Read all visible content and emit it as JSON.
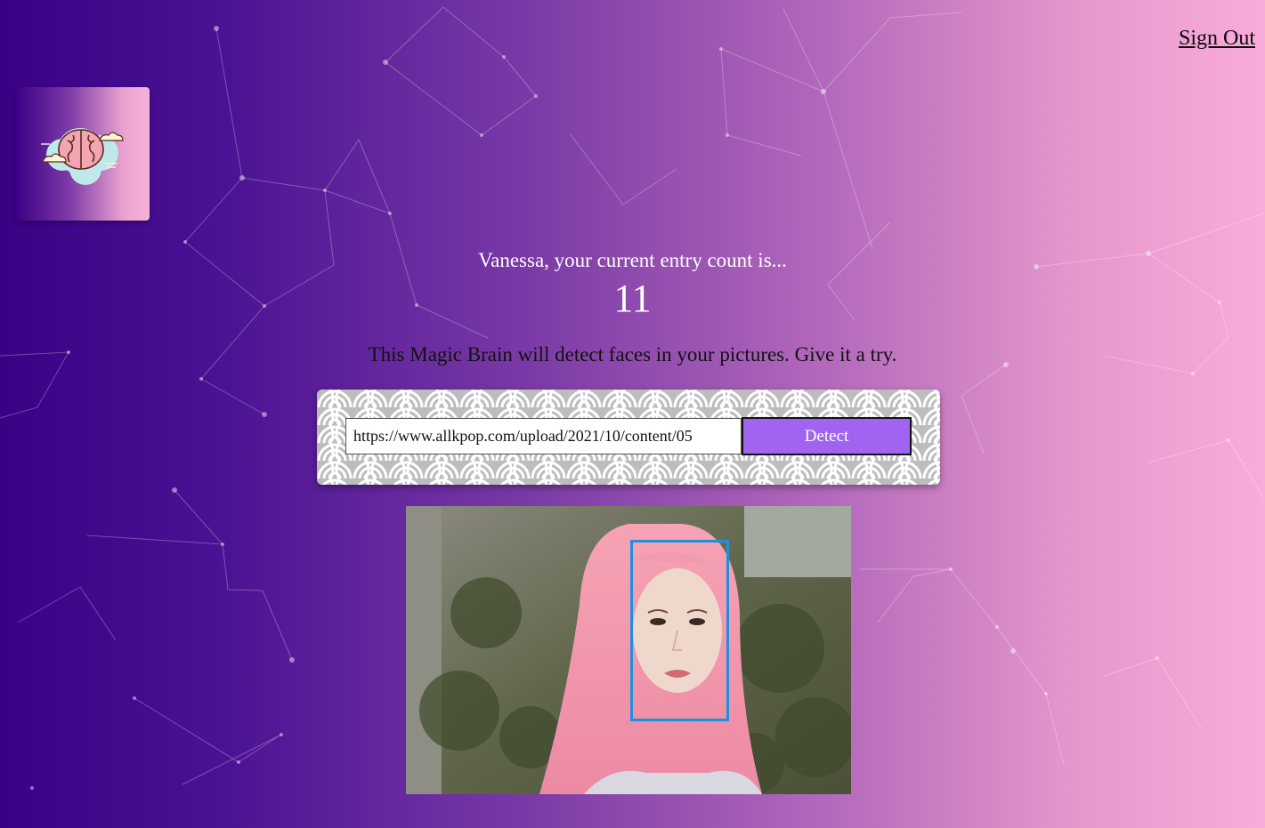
{
  "header": {
    "sign_out_label": "Sign Out"
  },
  "logo": {
    "icon": "brain-icon"
  },
  "rank": {
    "greeting": "Vanessa, your current entry count is...",
    "count": "11"
  },
  "intro": {
    "text": "This Magic Brain will detect faces in your pictures. Give it a try."
  },
  "form": {
    "url_value": "https://www.allkpop.com/upload/2021/10/content/05",
    "detect_label": "Detect"
  },
  "result": {
    "face_boxes_count": 1
  },
  "colors": {
    "accent_button": "#a064f0",
    "face_box": "#1f8fe0",
    "bg_start": "#3a0086",
    "bg_end": "#f9acd9"
  }
}
